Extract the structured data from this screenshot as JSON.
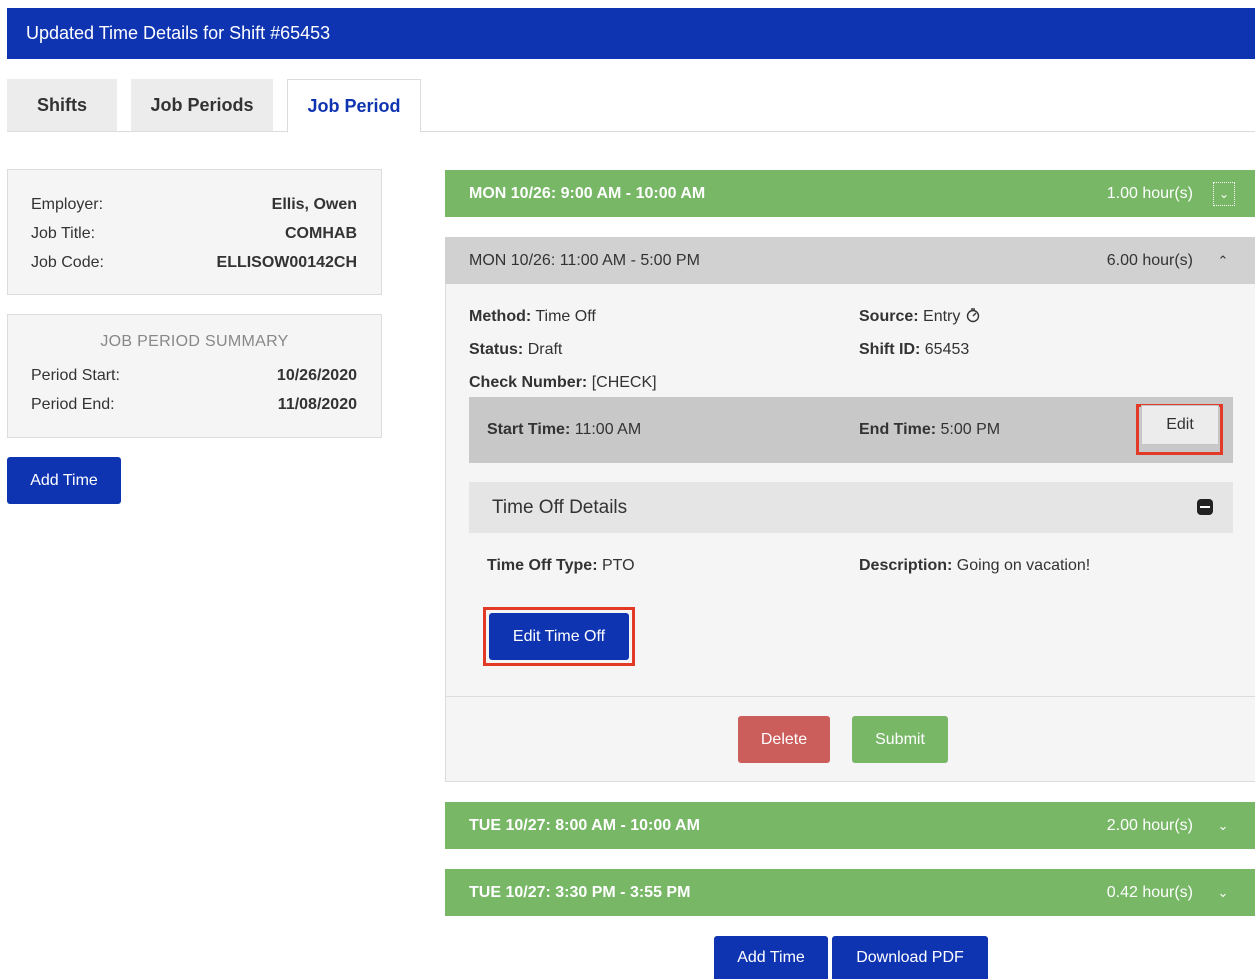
{
  "header": {
    "title": "Updated Time Details for Shift #65453"
  },
  "tabs": [
    {
      "label": "Shifts"
    },
    {
      "label": "Job Periods"
    },
    {
      "label": "Job Period"
    }
  ],
  "employer_panel": {
    "employer_label": "Employer:",
    "employer_value": "Ellis, Owen",
    "job_title_label": "Job Title:",
    "job_title_value": "COMHAB",
    "job_code_label": "Job Code:",
    "job_code_value": "ELLISOW00142CH"
  },
  "summary_panel": {
    "title": "JOB PERIOD SUMMARY",
    "start_label": "Period Start:",
    "start_value": "10/26/2020",
    "end_label": "Period End:",
    "end_value": "11/08/2020"
  },
  "sidebar": {
    "add_time_label": "Add Time"
  },
  "entries": [
    {
      "title": "MON 10/26: 9:00 AM - 10:00 AM",
      "hours": "1.00 hour(s)"
    },
    {
      "title": "MON 10/26: 11:00 AM - 5:00 PM",
      "hours": "6.00 hour(s)"
    },
    {
      "title": "TUE 10/27: 8:00 AM - 10:00 AM",
      "hours": "2.00 hour(s)"
    },
    {
      "title": "TUE 10/27: 3:30 PM - 3:55 PM",
      "hours": "0.42 hour(s)"
    }
  ],
  "details": {
    "method_label": "Method:",
    "method_value": "Time Off",
    "source_label": "Source:",
    "source_value": "Entry",
    "status_label": "Status:",
    "status_value": "Draft",
    "shift_id_label": "Shift ID:",
    "shift_id_value": "65453",
    "check_label": "Check Number:",
    "check_value": "[CHECK]",
    "start_time_label": "Start Time:",
    "start_time_value": "11:00 AM",
    "end_time_label": "End Time:",
    "end_time_value": "5:00 PM",
    "edit_label": "Edit"
  },
  "time_off": {
    "heading": "Time Off Details",
    "type_label": "Time Off Type:",
    "type_value": "PTO",
    "desc_label": "Description:",
    "desc_value": "Going on vacation!",
    "edit_label": "Edit Time Off"
  },
  "actions": {
    "delete_label": "Delete",
    "submit_label": "Submit"
  },
  "footer": {
    "add_time_label": "Add Time",
    "download_label": "Download PDF"
  },
  "colors": {
    "primary": "#0f34b2",
    "success": "#77b766",
    "danger": "#cb5d5a",
    "highlight": "#e23a26"
  },
  "icons": {
    "collapsed": "chevron-down-icon",
    "expanded": "chevron-up-icon",
    "source": "stopwatch-icon",
    "section_toggle": "minus-square-icon"
  }
}
